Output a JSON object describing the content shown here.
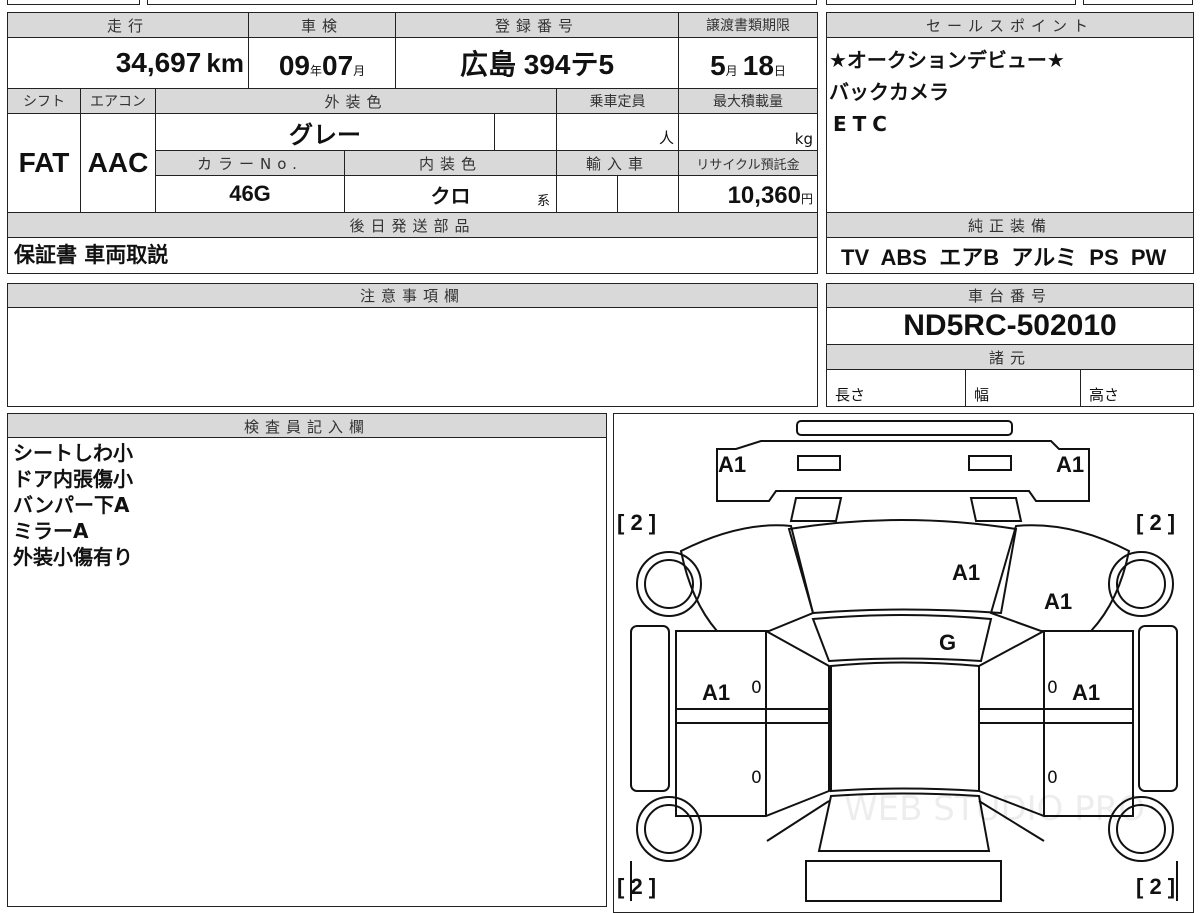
{
  "main": {
    "mileage_label": "走行",
    "mileage": "34,697",
    "mileage_unit": "km",
    "inspection_label": "車検",
    "insp_year": "09",
    "insp_year_unit": "年",
    "insp_month": "07",
    "insp_month_unit": "月",
    "reg_label": "登録番号",
    "reg_number": "広島 394テ5",
    "transfer_label": "譲渡書類期限",
    "transfer_month": "5",
    "transfer_month_unit": "月",
    "transfer_day": "18",
    "transfer_day_unit": "日",
    "shift_label": "シフト",
    "shift": "FAT",
    "ac_label": "エアコン",
    "ac": "AAC",
    "ext_color_label": "外装色",
    "ext_color": "グレー",
    "capacity_label": "乗車定員",
    "capacity_unit": "人",
    "load_label": "最大積載量",
    "load_unit": "kg",
    "color_no_label": "カラーNo.",
    "color_no": "46G",
    "int_color_label": "内装色",
    "int_color": "クロ",
    "int_color_suffix": "系",
    "import_label": "輸入車",
    "recycle_label": "リサイクル預託金",
    "recycle": "10,360",
    "recycle_unit": "円",
    "later_parts_label": "後日発送部品",
    "later_parts": "保証書 車両取説"
  },
  "sales": {
    "label": "セールスポイント",
    "lines": [
      "★オークションデビュー★",
      "バックカメラ",
      "ETC"
    ]
  },
  "equipment": {
    "label": "純正装備",
    "items": "TV  ABS  エアB  アルミ  PS  PW"
  },
  "notes": {
    "label": "注意事項欄"
  },
  "chassis": {
    "label": "車台番号",
    "number": "ND5RC-502010",
    "spec_label": "諸元",
    "length": "長さ",
    "width": "幅",
    "height": "高さ"
  },
  "inspector": {
    "label": "検査員記入欄",
    "lines": [
      "シートしわ小",
      "ドア内張傷小",
      "バンパー下A",
      "ミラーA",
      "外装小傷有り"
    ]
  },
  "diagram": {
    "front_left": "A1",
    "front_right": "A1",
    "bracket": "[ 2 ]",
    "hood": "A1",
    "windshield": "G",
    "right_fender": "A1",
    "left_door": "A1",
    "right_door": "A1",
    "zero": "0",
    "watermark": "WEB STUDIO PRO"
  }
}
